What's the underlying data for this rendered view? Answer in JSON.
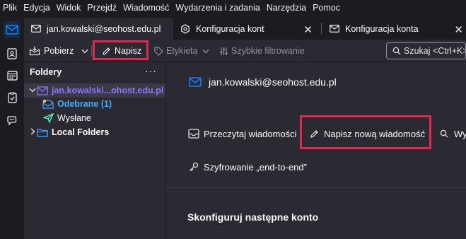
{
  "menubar": {
    "items": [
      "Plik",
      "Edycja",
      "Widok",
      "Przejdź",
      "Wiadomość",
      "Wydarzenia i zadania",
      "Narzędzia",
      "Pomoc"
    ]
  },
  "spaces": {
    "items": [
      "mail-icon",
      "address-book-icon",
      "calendar-icon",
      "tasks-icon",
      "chat-icon"
    ]
  },
  "tabs": [
    {
      "label": "jan.kowalski@seohost.edu.pl",
      "icon": "mail-icon",
      "selected": true
    },
    {
      "label": "Konfiguracja kont",
      "icon": "settings-icon",
      "selected": false
    },
    {
      "label": "Konfiguracja konta",
      "icon": "mail-icon",
      "selected": false
    }
  ],
  "toolbar": {
    "get_messages": "Pobierz",
    "write": "Napisz",
    "tag": "Etykieta",
    "quick_filter": "Szybkie filtrowanie",
    "search_placeholder": "Szukaj <Ctrl+K>"
  },
  "folder_pane": {
    "title": "Foldery",
    "more": "···",
    "account": "jan.kowalski...ohost.edu.pl",
    "inbox": "Odebrane (1)",
    "sent": "Wysłane",
    "local": "Local Folders"
  },
  "main": {
    "account_title": "jan.kowalski@seohost.edu.pl",
    "read_messages": "Przeczytaj wiadomości",
    "write_new": "Napisz nową wiadomość",
    "search_partial": "Wys",
    "e2e": "Szyfrowanie „end-to-end”",
    "setup_title": "Skonfiguruj następne konto"
  },
  "colors": {
    "accent": "#0a84ff",
    "highlight": "#e22850",
    "inbox_text": "#3bb0ff",
    "sent_green": "#54ffbd",
    "folder_blue": "#45a1ff",
    "account_purple": "#8e75ff"
  }
}
